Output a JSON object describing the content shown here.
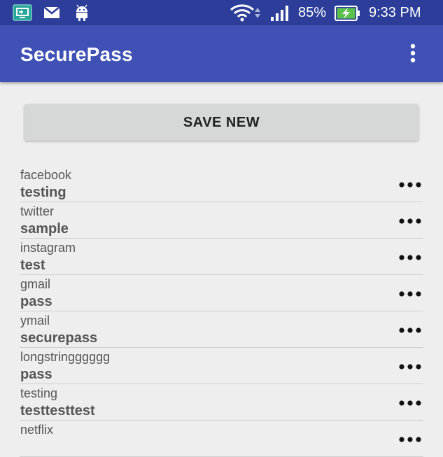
{
  "status_bar": {
    "icons": [
      "screen-mirror-icon",
      "gmail-icon",
      "android-icon",
      "wifi-icon",
      "signal-icon",
      "battery-charging-icon"
    ],
    "battery": "85%",
    "time": "9:33 PM"
  },
  "app_bar": {
    "title": "SecurePass",
    "menu_icon": "more-vert-icon"
  },
  "save_button": {
    "label": "SAVE NEW"
  },
  "entries": [
    {
      "site": "facebook",
      "password": "testing"
    },
    {
      "site": "twitter",
      "password": "sample"
    },
    {
      "site": "instagram",
      "password": "test"
    },
    {
      "site": "gmail",
      "password": "pass"
    },
    {
      "site": "ymail",
      "password": "securepass"
    },
    {
      "site": "longstringggggg",
      "password": "pass"
    },
    {
      "site": "testing",
      "password": "testtesttest"
    },
    {
      "site": "netflix",
      "password": ""
    }
  ],
  "colors": {
    "status_bar": "#2d3e9a",
    "app_bar": "#3f51b5",
    "background": "#eeeeee",
    "button": "#d6d7d7"
  }
}
